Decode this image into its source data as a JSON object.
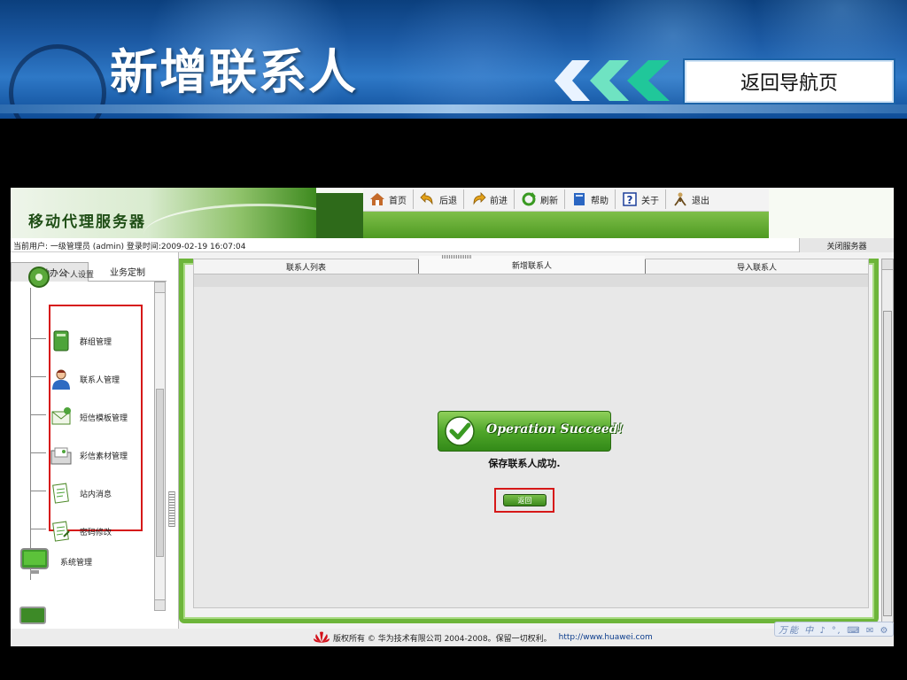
{
  "slide": {
    "title": "新增联系人",
    "nav_back_label": "返回导航页"
  },
  "app": {
    "logo_text": "移动代理服务器",
    "toolbar": [
      {
        "label": "首页",
        "icon": "home-icon"
      },
      {
        "label": "后退",
        "icon": "back-arrow-icon"
      },
      {
        "label": "前进",
        "icon": "forward-arrow-icon"
      },
      {
        "label": "刷新",
        "icon": "refresh-icon"
      },
      {
        "label": "帮助",
        "icon": "help-book-icon"
      },
      {
        "label": "关于",
        "icon": "question-icon"
      },
      {
        "label": "退出",
        "icon": "exit-person-icon"
      }
    ],
    "status": {
      "user_info": "当前用户: 一级管理员 (admin) 登录时间:2009-02-19 16:07:04",
      "close_server": "关闭服务器"
    },
    "sidebar": {
      "tabs": [
        "移动办公",
        "业务定制"
      ],
      "section_label": "个人设置",
      "items": [
        {
          "label": "群组管理",
          "icon": "group-book-icon"
        },
        {
          "label": "联系人管理",
          "icon": "contact-person-icon"
        },
        {
          "label": "短信模板管理",
          "icon": "sms-envelope-icon"
        },
        {
          "label": "彩信素材管理",
          "icon": "mms-folder-icon"
        },
        {
          "label": "站内消息",
          "icon": "message-note-icon"
        },
        {
          "label": "密码修改",
          "icon": "password-note-icon"
        }
      ],
      "system_item": {
        "label": "系统管理",
        "icon": "monitor-icon"
      }
    },
    "tabs": [
      "联系人列表",
      "新增联系人",
      "导入联系人"
    ],
    "active_tab": "新增联系人",
    "result": {
      "badge_text": "Operation Succeed!",
      "message": "保存联系人成功.",
      "back_button": "返回"
    },
    "footer": {
      "copyright": "版权所有 © 华为技术有限公司 2004-2008。保留一切权利。",
      "url": "http://www.huawei.com"
    },
    "ime_text": "万能 中 ♪ °, ⌨ ✉ ⚙"
  },
  "colors": {
    "banner_blue": "#1c5aa4",
    "app_green": "#4e9a22",
    "highlight_red": "#d61818"
  }
}
